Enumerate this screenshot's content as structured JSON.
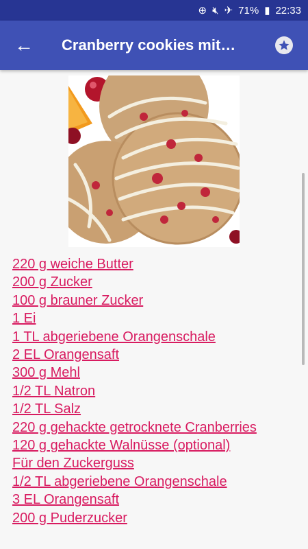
{
  "status_bar": {
    "battery_percent": "71%",
    "time": "22:33"
  },
  "app_bar": {
    "title": "Cranberry cookies mit…"
  },
  "recipe": {
    "ingredients": [
      "220 g weiche Butter",
      "200 g Zucker",
      "100 g brauner Zucker",
      "1 Ei",
      "1 TL abgeriebene Orangenschale",
      "2 EL Orangensaft",
      "300 g Mehl",
      "1/2 TL Natron",
      "1/2 TL Salz",
      "220 g gehackte getrocknete Cranberries",
      "120 g gehackte Walnüsse (optional)",
      "Für den Zuckerguss",
      "1/2 TL abgeriebene Orangenschale",
      "3 EL Orangensaft",
      "200 g Puderzucker"
    ]
  },
  "colors": {
    "status_bar": "#273593",
    "app_bar": "#3f51b5",
    "link": "#d81b60"
  }
}
